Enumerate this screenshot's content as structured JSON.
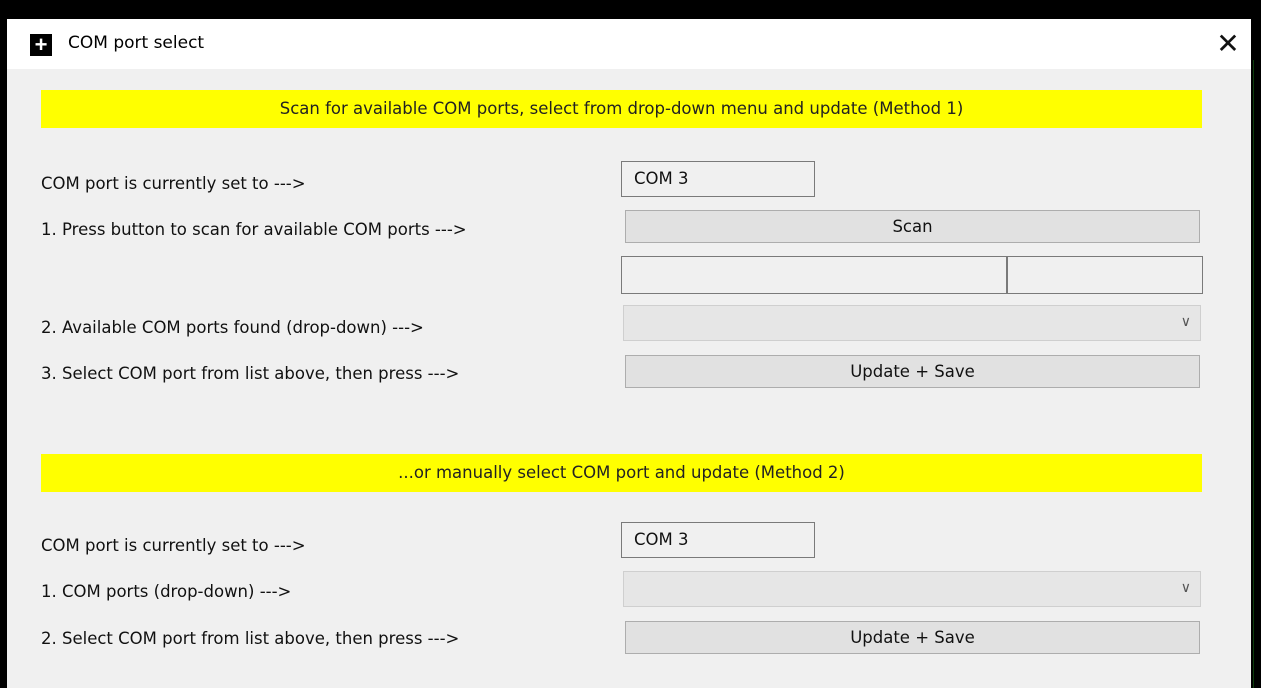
{
  "window": {
    "title": "COM port select",
    "close_glyph": "✕"
  },
  "method1": {
    "banner": "Scan for available COM ports, select from drop-down menu and update (Method 1)",
    "current_label": "COM port is currently set to --->",
    "current_value": "COM 3",
    "scan_label": "1. Press button to scan for available COM ports --->",
    "scan_button": "Scan",
    "available_label": "2. Available COM ports found (drop-down) --->",
    "available_selected": "",
    "update_label": "3. Select COM port from list above, then press --->",
    "update_button": "Update + Save"
  },
  "method2": {
    "banner": "...or manually select COM port and update (Method 2)",
    "current_label": "COM port is currently set to --->",
    "current_value": "COM 3",
    "ports_label": "1. COM ports (drop-down) --->",
    "ports_selected": "",
    "update_label": "2. Select COM port from list above, then press --->",
    "update_button": "Update + Save"
  },
  "colors": {
    "banner": "#ffff00",
    "window_bg": "#f0f0f0",
    "button_bg": "#e1e1e1"
  },
  "icons": {
    "app": "plus-icon",
    "close": "close-icon",
    "dropdown": "chevron-down-icon"
  }
}
